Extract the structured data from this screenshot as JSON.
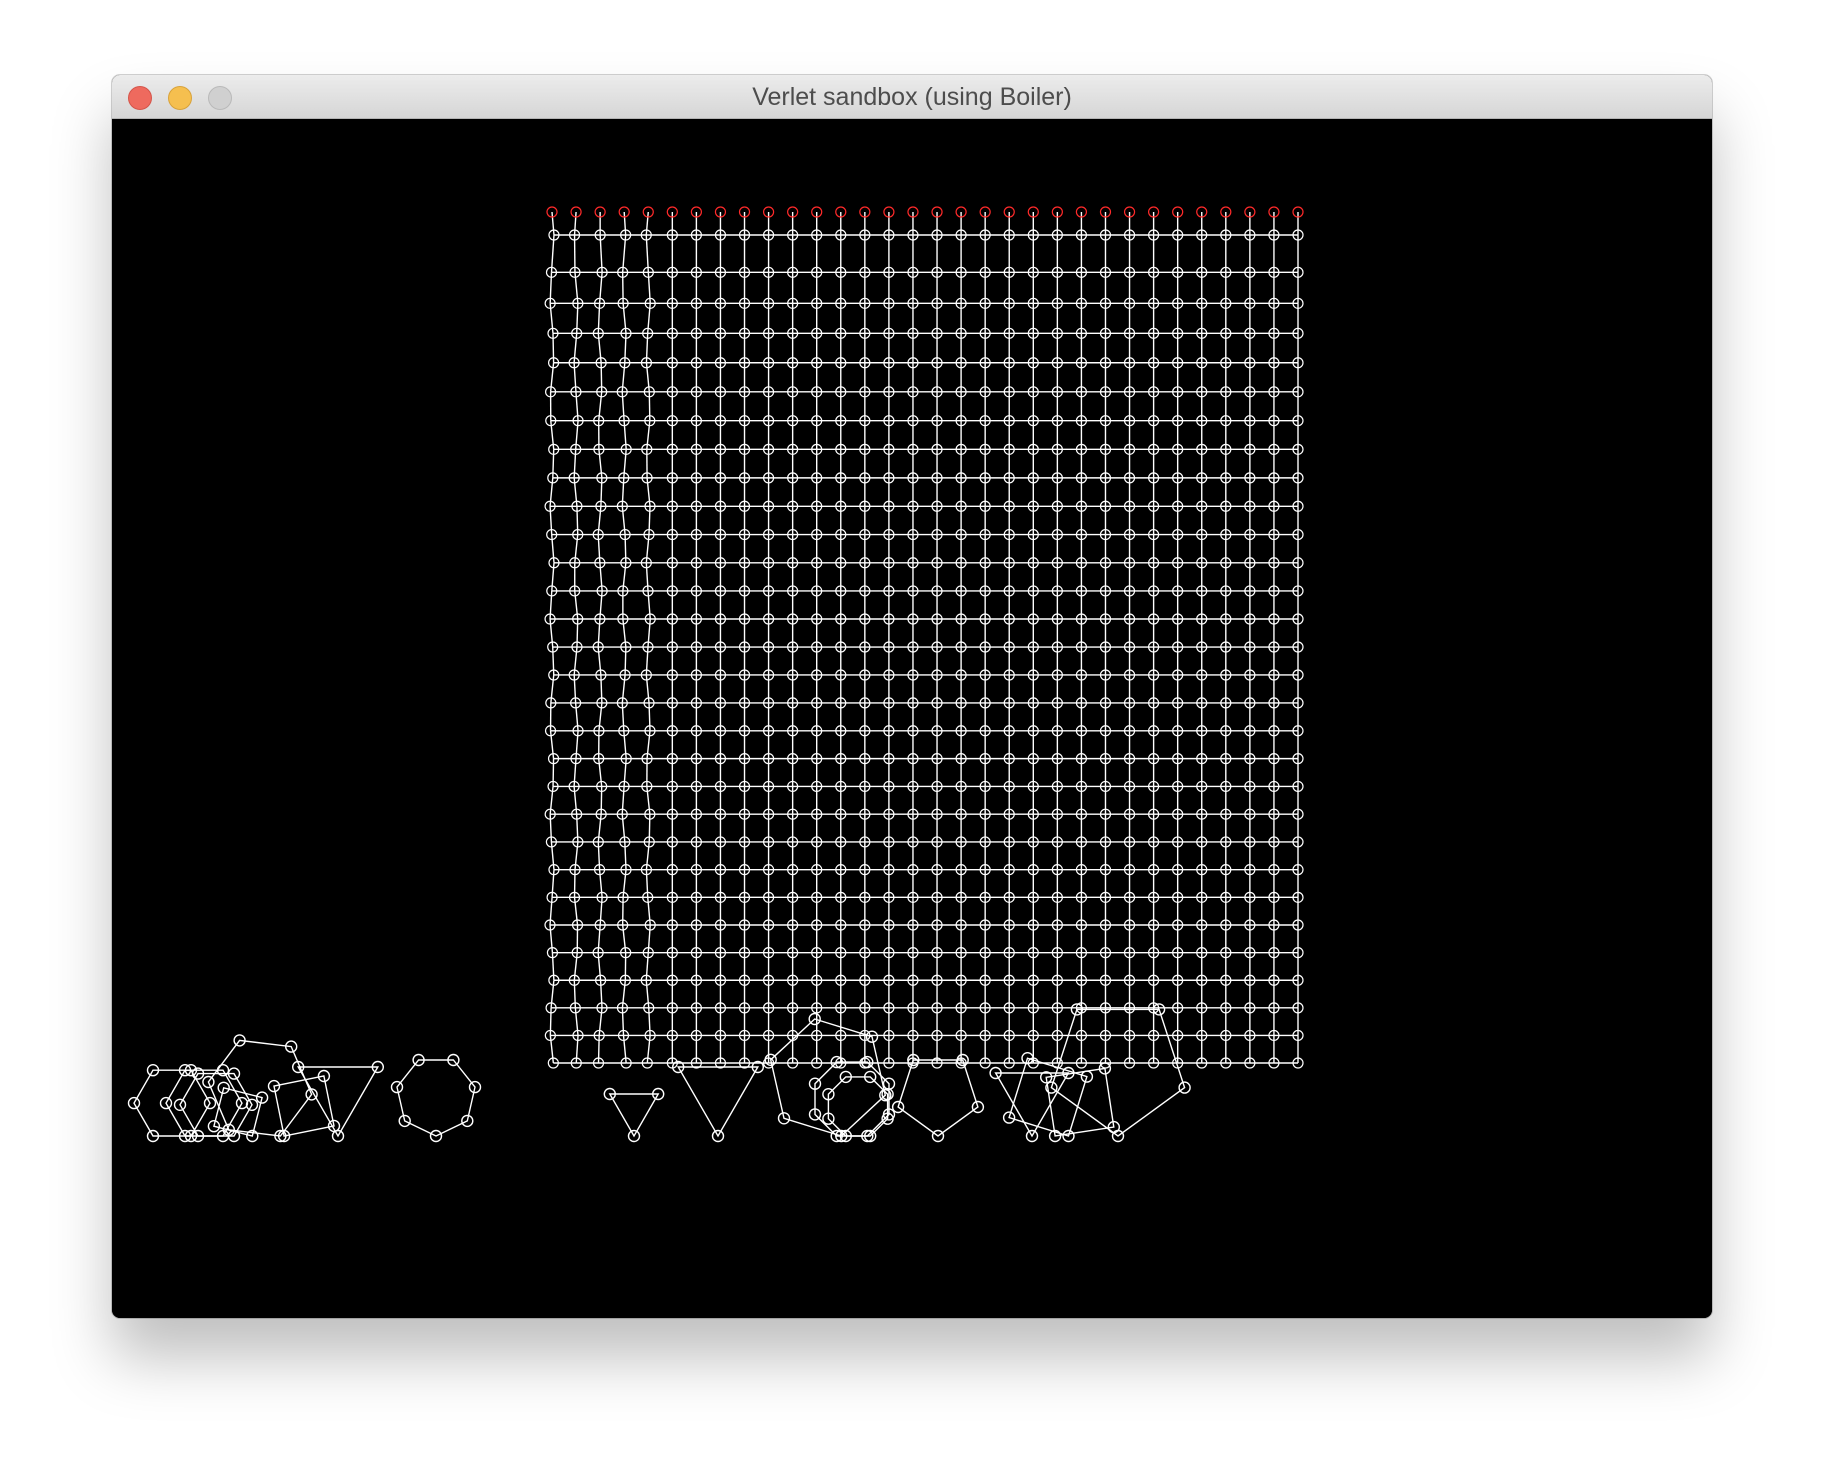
{
  "window": {
    "title": "Verlet sandbox (using Boiler)",
    "controls": [
      "close",
      "minimize",
      "maximize"
    ]
  },
  "canvas": {
    "background": "#000000",
    "stroke_color": "#ffffff",
    "pinned_color": "#ff2a2a",
    "cloth": {
      "columns": 32,
      "rows": 31,
      "pinned_row": "top"
    },
    "shapes": [
      {
        "kind": "hexagon"
      },
      {
        "kind": "hexagon"
      },
      {
        "kind": "hexagon"
      },
      {
        "kind": "square"
      },
      {
        "kind": "hexagon"
      },
      {
        "kind": "square"
      },
      {
        "kind": "triangle"
      },
      {
        "kind": "heptagon"
      },
      {
        "kind": "triangle"
      },
      {
        "kind": "triangle"
      },
      {
        "kind": "hexagon"
      },
      {
        "kind": "octagon"
      },
      {
        "kind": "octagon"
      },
      {
        "kind": "pentagon"
      },
      {
        "kind": "square"
      },
      {
        "kind": "square"
      },
      {
        "kind": "triangle"
      },
      {
        "kind": "pentagon"
      }
    ]
  }
}
